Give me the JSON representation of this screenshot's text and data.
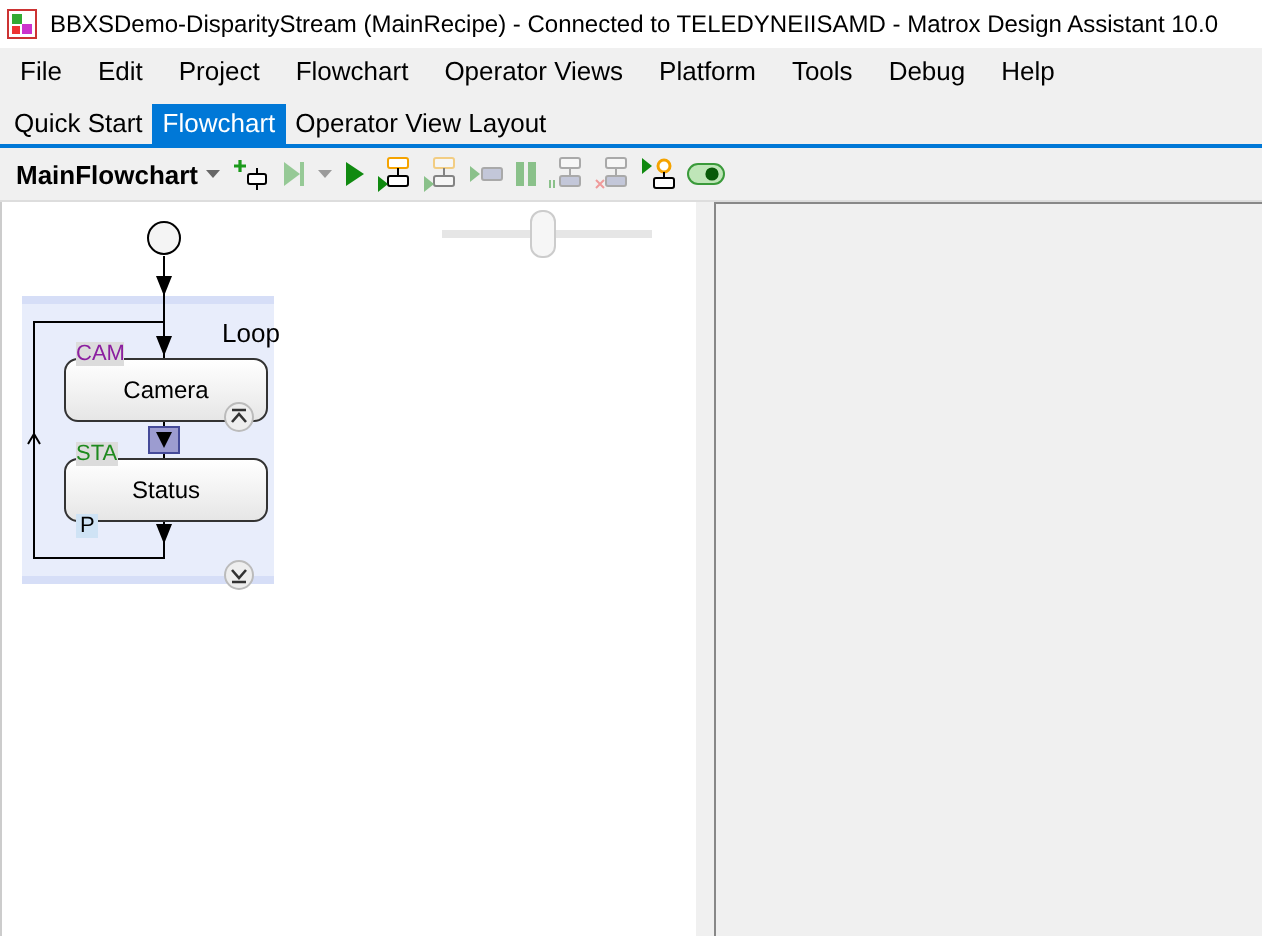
{
  "window": {
    "title": "BBXSDemo-DisparityStream (MainRecipe) - Connected to TELEDYNEIISAMD - Matrox Design Assistant 10.0"
  },
  "menu": [
    "File",
    "Edit",
    "Project",
    "Flowchart",
    "Operator Views",
    "Platform",
    "Tools",
    "Debug",
    "Help"
  ],
  "tabs": [
    {
      "label": "Quick Start",
      "selected": false
    },
    {
      "label": "Flowchart",
      "selected": true
    },
    {
      "label": "Operator View Layout",
      "selected": false
    }
  ],
  "toolbar": {
    "flowchart_select": "MainFlowchart",
    "tools": [
      {
        "kind": "add-step",
        "disabled": false
      },
      {
        "kind": "run-to",
        "disabled": true
      },
      {
        "kind": "dropdown",
        "disabled": true
      },
      {
        "kind": "run",
        "disabled": false
      },
      {
        "kind": "step-into",
        "disabled": false
      },
      {
        "kind": "step-over",
        "disabled": true
      },
      {
        "kind": "step-out",
        "disabled": true
      },
      {
        "kind": "pause",
        "disabled": true
      },
      {
        "kind": "breakpoint",
        "disabled": true
      },
      {
        "kind": "clear-breakpoint",
        "disabled": true
      },
      {
        "kind": "start-here",
        "disabled": false
      },
      {
        "kind": "toggle",
        "disabled": false
      }
    ]
  },
  "canvas": {
    "zoom": {
      "level": 0.47
    },
    "loop": {
      "label": "Loop"
    },
    "steps": [
      {
        "name": "Camera",
        "tag": "CAM",
        "color": "#8b1fa0"
      },
      {
        "name": "Status",
        "tag": "STA",
        "color": "#1e8a1e",
        "badge": "P"
      }
    ]
  }
}
